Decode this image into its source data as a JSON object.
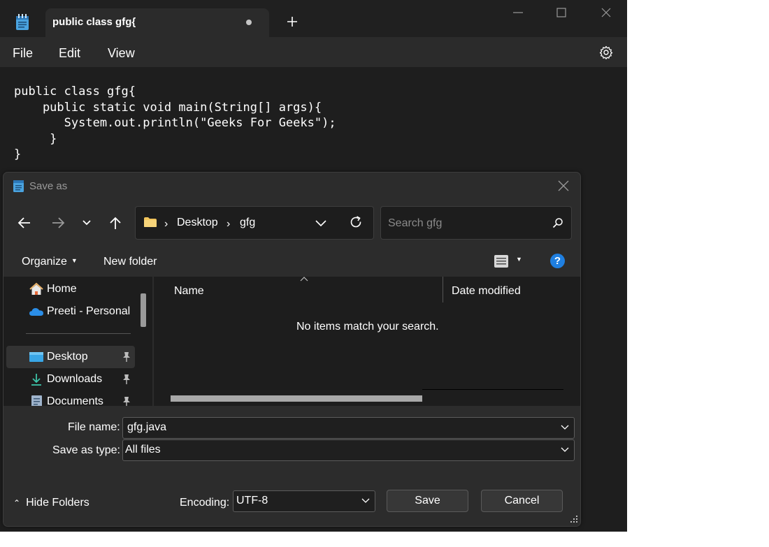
{
  "notepad": {
    "tab_title": "public class gfg{",
    "menu": [
      "File",
      "Edit",
      "View"
    ],
    "code_lines": [
      "public class gfg{",
      "    public static void main(String[] args){",
      "       System.out.println(\"Geeks For Geeks\");",
      "     }",
      "}"
    ]
  },
  "dialog": {
    "title": "Save as",
    "breadcrumb": [
      "Desktop",
      "gfg"
    ],
    "search_placeholder": "Search gfg",
    "organize_label": "Organize",
    "new_folder_label": "New folder",
    "help_label": "?",
    "nav_items": [
      {
        "label": "Home",
        "icon": "home-icon"
      },
      {
        "label": "Preeti - Personal",
        "icon": "cloud-icon"
      },
      {
        "label": "Desktop",
        "icon": "desktop-icon",
        "pinned": true,
        "selected": true
      },
      {
        "label": "Downloads",
        "icon": "download-icon",
        "pinned": true
      },
      {
        "label": "Documents",
        "icon": "document-icon",
        "pinned": true
      }
    ],
    "columns": [
      "Name",
      "Date modified"
    ],
    "empty_message": "No items match your search.",
    "file_name_label": "File name:",
    "file_name_value": "gfg.java",
    "save_type_label": "Save as type:",
    "save_type_value": "All files",
    "hide_folders_label": "Hide Folders",
    "encoding_label": "Encoding:",
    "encoding_value": "UTF-8",
    "save_label": "Save",
    "cancel_label": "Cancel"
  },
  "colors": {
    "accent": "#1f7fe0",
    "folder": "#f2c55c",
    "dark_bg": "#1e1e1e"
  }
}
